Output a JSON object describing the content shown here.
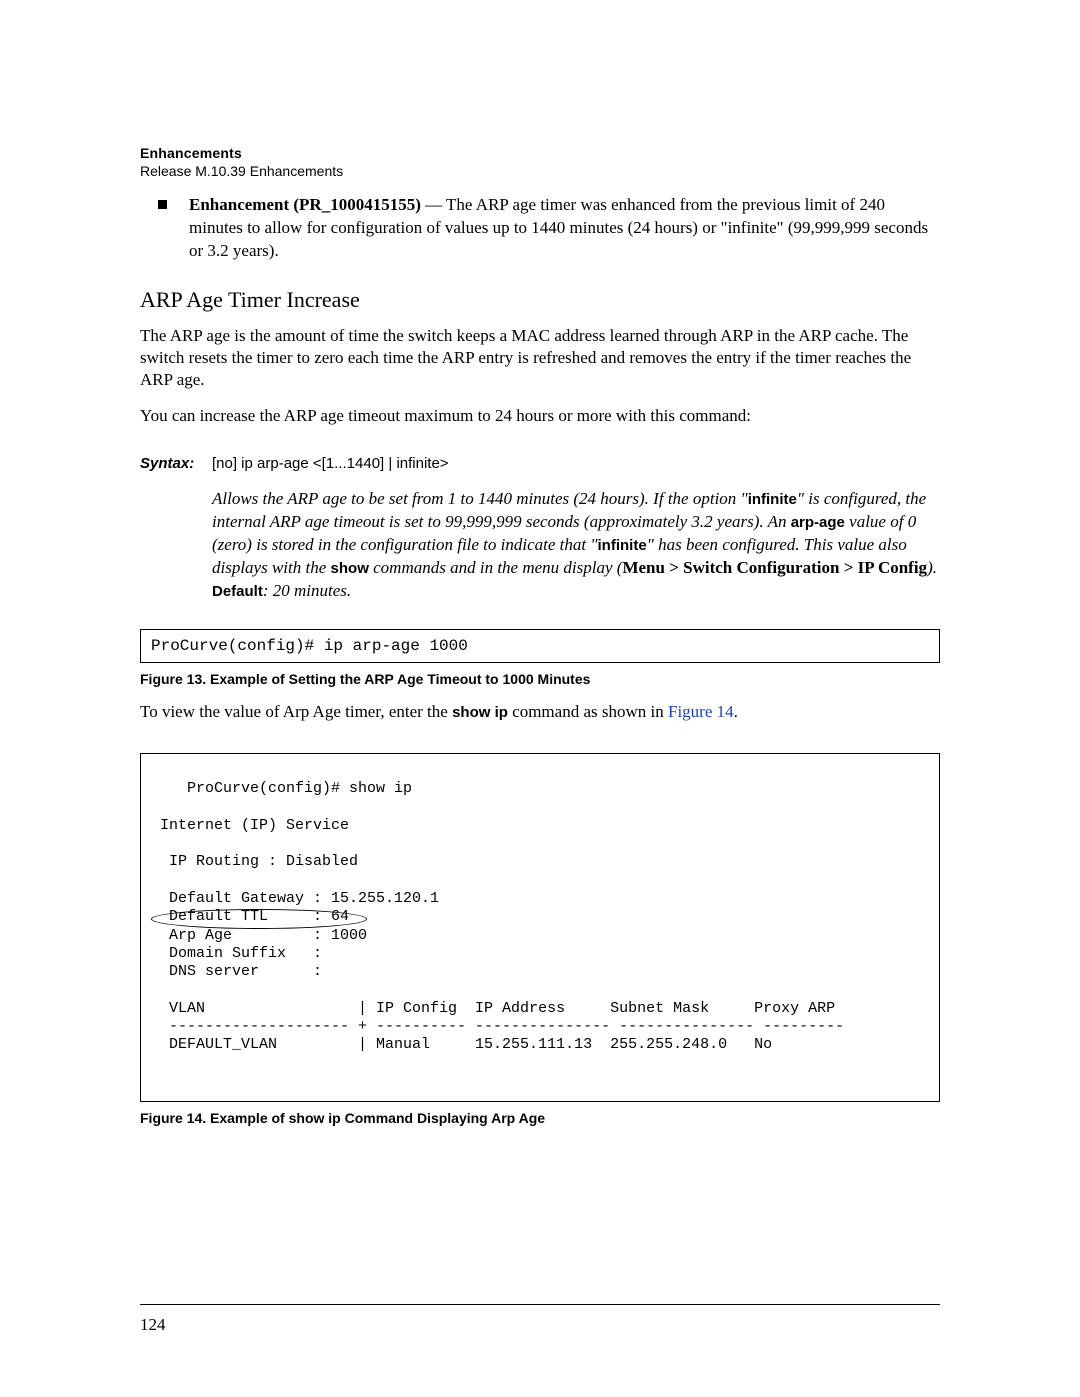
{
  "header": {
    "title": "Enhancements",
    "subtitle": "Release M.10.39 Enhancements"
  },
  "bullet": {
    "lead": "Enhancement (PR_1000415155)",
    "rest": " — The ARP age timer was enhanced from the previous limit of 240 minutes to allow for configuration of values up to 1440 minutes (24 hours) or \"infinite\" (99,999,999 seconds or 3.2 years)."
  },
  "section_heading": "ARP Age Timer Increase",
  "para1": "The ARP age is the amount of time the switch keeps a MAC address learned through ARP in the ARP cache. The switch resets the timer to zero each time the ARP entry is refreshed and removes the entry if the timer reaches the ARP age.",
  "para2": "You can increase the ARP age timeout maximum to 24 hours or more with this command:",
  "syntax": {
    "label": "Syntax:",
    "command": "[no] ip arp-age <[1...1440] | infinite>",
    "desc_pre": "Allows the ARP age to be set from 1 to 1440 minutes (24 hours). If the option \"",
    "inf1": "infinite",
    "desc_mid1": "\" is configured, the internal ARP age timeout is set to 99,999,999 seconds (approximately 3.2 years). An ",
    "arpage": "arp-age",
    "desc_mid2": " value of 0 (zero) is stored in the configuration file to indicate that \"",
    "inf2": "infinite",
    "desc_mid3": "\" has been configured. This value also displays with the ",
    "show": "show",
    "desc_mid4": " commands and in the menu display (",
    "menu": "Menu > Switch Configuration > IP Config",
    "desc_end": ").",
    "default_label": "Default",
    "default_val": ": 20 minutes."
  },
  "code1": "ProCurve(config)# ip arp-age 1000",
  "fig13": "Figure 13.  Example of Setting the ARP Age Timeout to 1000 Minutes",
  "para3_pre": "To view the value of Arp Age timer, enter the ",
  "para3_bold": "show ip",
  "para3_mid": " command as shown in ",
  "para3_link": "Figure 14",
  "para3_end": ".",
  "code2": "ProCurve(config)# show ip\n\n Internet (IP) Service\n\n  IP Routing : Disabled\n\n  Default Gateway : 15.255.120.1\n  Default TTL     : 64\n  Arp Age         : 1000\n  Domain Suffix   :\n  DNS server      :\n\n  VLAN                 | IP Config  IP Address     Subnet Mask     Proxy ARP\n  -------------------- + ---------- --------------- --------------- ---------\n  DEFAULT_VLAN         | Manual     15.255.111.13  255.255.248.0   No",
  "fig14": "Figure 14.  Example of show ip Command Displaying Arp Age",
  "page_number": "124"
}
